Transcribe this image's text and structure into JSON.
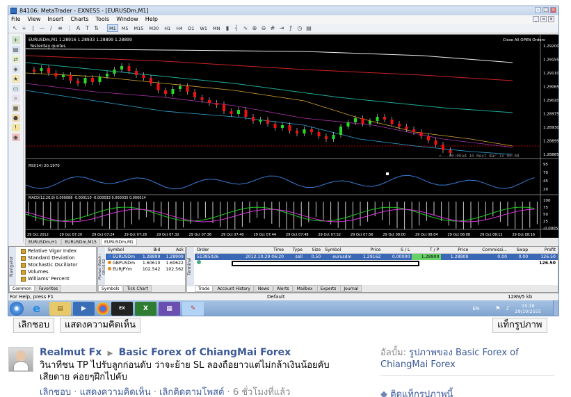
{
  "window": {
    "title": "84106: MetaTrader - EXNESS - [EURUSDm,M1]"
  },
  "menu": [
    "File",
    "View",
    "Insert",
    "Charts",
    "Tools",
    "Window",
    "Help"
  ],
  "timeframes": [
    "M1",
    "M5",
    "M15",
    "M30",
    "H1",
    "H4",
    "D1",
    "W1",
    "MN"
  ],
  "active_timeframe": "M1",
  "chart": {
    "header": "EURUSDm,M1  1.28916 1.28933 1.28899 1.28899",
    "order_overlay": [
      "Yesterday quotes",
      "Close All OPEN Orders"
    ],
    "price_ticks": [
      "1.29200",
      "1.29155",
      "1.29110",
      "1.29065",
      "1.29020",
      "1.28975",
      "1.28930",
      "1.28899",
      "1.28885"
    ],
    "next_bar_text": "<---00:00ad  10  Next Bar in 00:08",
    "rsi_label": "RSI(14) 20.1970",
    "rsi_ticks": [
      "95",
      "70",
      "45",
      "20"
    ],
    "macd_label": "MACD(12,26,9) 0.000088 -0.000110 -0.000033 0.000035 0.000014",
    "macd_ticks": [
      "100",
      "75",
      "50",
      "25",
      "-0.00053"
    ],
    "time_ticks": [
      "29 Oct 2012",
      "29 Oct 07:20",
      "29 Oct 07:24",
      "29 Oct 07:28",
      "29 Oct 07:32",
      "29 Oct 07:36",
      "29 Oct 07:40",
      "29 Oct 07:44",
      "29 Oct 07:48",
      "29 Oct 07:52",
      "29 Oct 07:56",
      "29 Oct 08:00",
      "29 Oct 08:04",
      "29 Oct 08:08",
      "29 Oct 08:12",
      "29 Oct 08:16"
    ],
    "tabs": [
      "EURUSDm,H1",
      "EURUSDm,M15",
      "EURUSDm,M1"
    ],
    "active_tab": "EURUSDm,M1"
  },
  "navigator": {
    "side_label": "Navigator",
    "items": [
      "Relative Vigor Index",
      "Standard Deviation",
      "Stochastic Oscillator",
      "Volumes",
      "Williams' Percent"
    ],
    "tabs": [
      "Common",
      "Favorites"
    ]
  },
  "market_watch": {
    "side_label": "Market Watch: 08:16:52",
    "headers": [
      "Symbol",
      "Bid",
      "Ask"
    ],
    "rows": [
      [
        "EURUSDm",
        "1.28899",
        "1.28909"
      ],
      [
        "GBPUSDm",
        "1.60610",
        "1.60622"
      ],
      [
        "EURJPYm",
        "102.542",
        "102.562"
      ]
    ],
    "tabs": [
      "Symbols",
      "Tick Chart"
    ]
  },
  "terminal": {
    "side_label": "Terminal",
    "headers": [
      "Order",
      "Time",
      "Type",
      "Size",
      "Symbol",
      "Price",
      "S / L",
      "T / P",
      "Price",
      "Commissi...",
      "Swap",
      "Profit"
    ],
    "rows": [
      [
        "51385026",
        "2012.10.29 06:20",
        "sell",
        "0.50",
        "eurusdm",
        "1.29162",
        "0.00000",
        "1.28900",
        "1.28909",
        "0.00",
        "0.00",
        "126.50"
      ]
    ],
    "balance_profit": "126.50",
    "tabs": [
      "Trade",
      "Account History",
      "News",
      "Alerts",
      "Mailbox",
      "Experts",
      "Journal"
    ]
  },
  "status": {
    "help": "For Help, press F1",
    "profile": "Default",
    "traffic": "1289/5 kb"
  },
  "taskbar": {
    "lang": "EN",
    "time": "15:18",
    "date": "29/10/2555"
  },
  "facebook": {
    "buttons": {
      "unlike": "เลิกชอบ",
      "show_comments": "แสดงความคิดเห็น",
      "tag_photo": "แท็กรูปภาพ"
    },
    "author": "Realmut Fx",
    "target": "Basic Forex of ChiangMai Forex",
    "caption": "วินาทีชน TP ไปรับลูกก่อนดับ ว่าจะย้าย SL ลองถือยาวแต่ไม่กล้าเงินน้อยคับ เสียดาย ค่อยๆฝึกไปคับ",
    "actions": [
      "เลิกชอบ",
      "แสดงความคิดเห็น",
      "เลิกติดตามโพสต์",
      "6 ชั่วโมงที่แล้ว"
    ],
    "album_label": "อัลบั้ม:",
    "album_name": "รูปภาพของ Basic Forex of ChiangMai Forex",
    "tag_this_photo": "ติดแท็กรูปภาพนี้"
  }
}
